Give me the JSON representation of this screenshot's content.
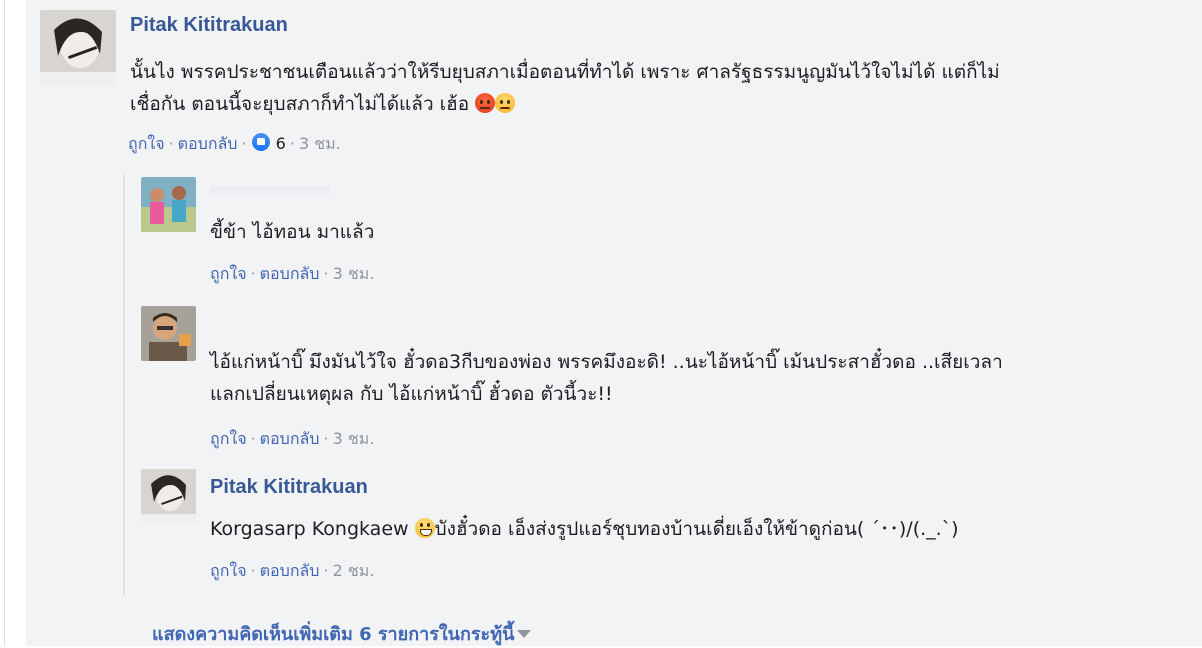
{
  "comments": {
    "c1": {
      "author": "Pitak Kititrakuan",
      "line1": "นั้นไง พรรคประชาชนเตือนแล้วว่าให้รีบยุบสภาเมื่อตอนที่ทำได้ เพราะ ศาลรัฐธรรมนูญมันไว้ใจไม่ได้ แต่ก็ไม่",
      "line2": "เชื่อกัน ตอนนี้จะยุบสภาก็ทำไม่ได้แล้ว เฮ้อ",
      "like": "ถูกใจ",
      "reply": "ตอบกลับ",
      "reactions": "6",
      "time": "3 ชม."
    },
    "r1": {
      "text": "ขี้ข้า ไอ้ทอน มาแล้ว",
      "like": "ถูกใจ",
      "reply": "ตอบกลับ",
      "time": "3 ชม."
    },
    "r2": {
      "line1": "ไอ้แก่หน้าบิ๊ มึงมันไว้ใจ ฮั๋วดอ3กีบของพ่อง พรรคมึงอะดิ! ..นะไอ้หน้าบิ๊ เม้นประสาฮั๋วดอ ..เสียเวลา",
      "line2": "แลกเปลี่ยนเหตุผล กับ ไอ้แก่หน้าบิ๊ ฮั๋วดอ ตัวนี้วะ!!",
      "like": "ถูกใจ",
      "reply": "ตอบกลับ",
      "time": "3 ชม."
    },
    "r3": {
      "author": "Pitak Kititrakuan",
      "mention": "Korgasarp Kongkaew",
      "text": "บังฮั๋วดอ เอ็งส่งรูปแอร์ชุบทองบ้านเดี่ยเอ็งให้ข้าดูก่อน( ´･･)/(._.`)",
      "like": "ถูกใจ",
      "reply": "ตอบกลับ",
      "time": "2 ชม."
    }
  },
  "more_link": "แสดงความคิดเห็นเพิ่มเติม 6 รายการในกระทู้นี้",
  "icons": {
    "angry": "angry-face-emoji",
    "sad": "frowning-face-emoji",
    "grin": "grinning-face-emoji",
    "like": "like-reaction-icon",
    "caret": "caret-down-icon"
  },
  "colors": {
    "background": "#f2f3f5",
    "link": "#4267b2",
    "name": "#385898",
    "meta": "#90949c"
  }
}
